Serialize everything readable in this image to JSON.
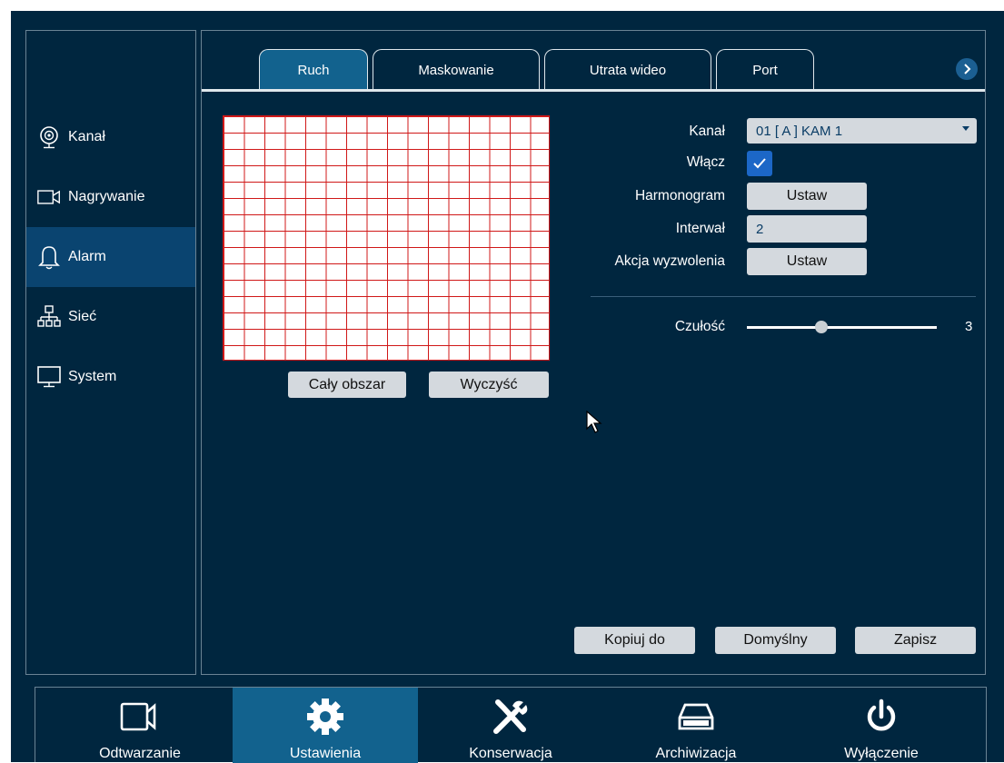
{
  "sidebar": {
    "items": [
      {
        "label": "Kanał",
        "icon": "camera-eye-icon"
      },
      {
        "label": "Nagrywanie",
        "icon": "video-camera-icon"
      },
      {
        "label": "Alarm",
        "icon": "bell-icon"
      },
      {
        "label": "Sieć",
        "icon": "network-icon"
      },
      {
        "label": "System",
        "icon": "monitor-icon"
      }
    ],
    "active": "Alarm"
  },
  "tabs": [
    {
      "label": "Ruch"
    },
    {
      "label": "Maskowanie"
    },
    {
      "label": "Utrata wideo"
    },
    {
      "label": "Port"
    }
  ],
  "active_tab": "Ruch",
  "grid": {
    "rows": 15,
    "cols": 16,
    "all_button": "Cały obszar",
    "clear_button": "Wyczyść"
  },
  "form": {
    "channel_label": "Kanał",
    "channel_value": "01 [ A ] KAM 1",
    "enable_label": "Włącz",
    "enable_checked": true,
    "schedule_label": "Harmonogram",
    "schedule_button": "Ustaw",
    "interval_label": "Interwał",
    "interval_value": "2",
    "trigger_label": "Akcja wyzwolenia",
    "trigger_button": "Ustaw",
    "sensitivity_label": "Czułość",
    "sensitivity_value": "3"
  },
  "actions": {
    "copy": "Kopiuj do",
    "default": "Domyślny",
    "save": "Zapisz"
  },
  "bottom": {
    "items": [
      {
        "label": "Odtwarzanie",
        "icon": "video-camera-icon"
      },
      {
        "label": "Ustawienia",
        "icon": "gear-icon"
      },
      {
        "label": "Konserwacja",
        "icon": "tools-icon"
      },
      {
        "label": "Archiwizacja",
        "icon": "archive-drive-icon"
      },
      {
        "label": "Wyłączenie",
        "icon": "power-icon"
      }
    ],
    "active": "Ustawienia"
  },
  "colors": {
    "background": "#00263f",
    "active": "#12628e",
    "grid_line": "#d01818",
    "checkbox": "#1c67c7"
  }
}
